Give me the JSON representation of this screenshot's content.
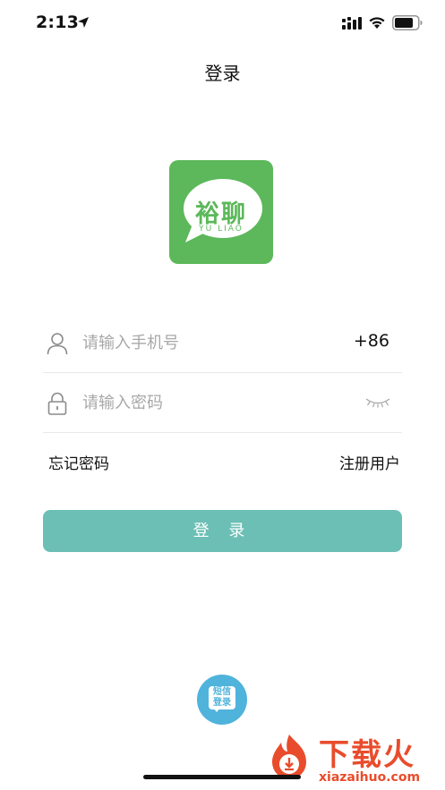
{
  "status_bar": {
    "time": "2:13",
    "icons": [
      "location-arrow-icon",
      "cellular-signal-icon",
      "wifi-icon",
      "battery-icon"
    ]
  },
  "nav": {
    "title": "登录"
  },
  "logo": {
    "text": "裕聊",
    "subtext": "YU LIAO",
    "color": "#5cb85a"
  },
  "form": {
    "phone": {
      "placeholder": "请输入手机号",
      "value": "",
      "country_code": "+86",
      "icon": "user-icon"
    },
    "password": {
      "placeholder": "请输入密码",
      "value": "",
      "icon": "lock-icon",
      "toggle_icon": "eye-closed-icon"
    }
  },
  "links": {
    "forgot_password": "忘记密码",
    "register": "注册用户"
  },
  "login_button": {
    "label": "登 录",
    "color": "#6cbfb5"
  },
  "sms_login": {
    "label_line1": "短信",
    "label_line2": "登录",
    "color": "#4fb3dc"
  },
  "watermark": {
    "title": "下载火",
    "url": "xiazaihuo.com",
    "color": "#e94c2c"
  }
}
